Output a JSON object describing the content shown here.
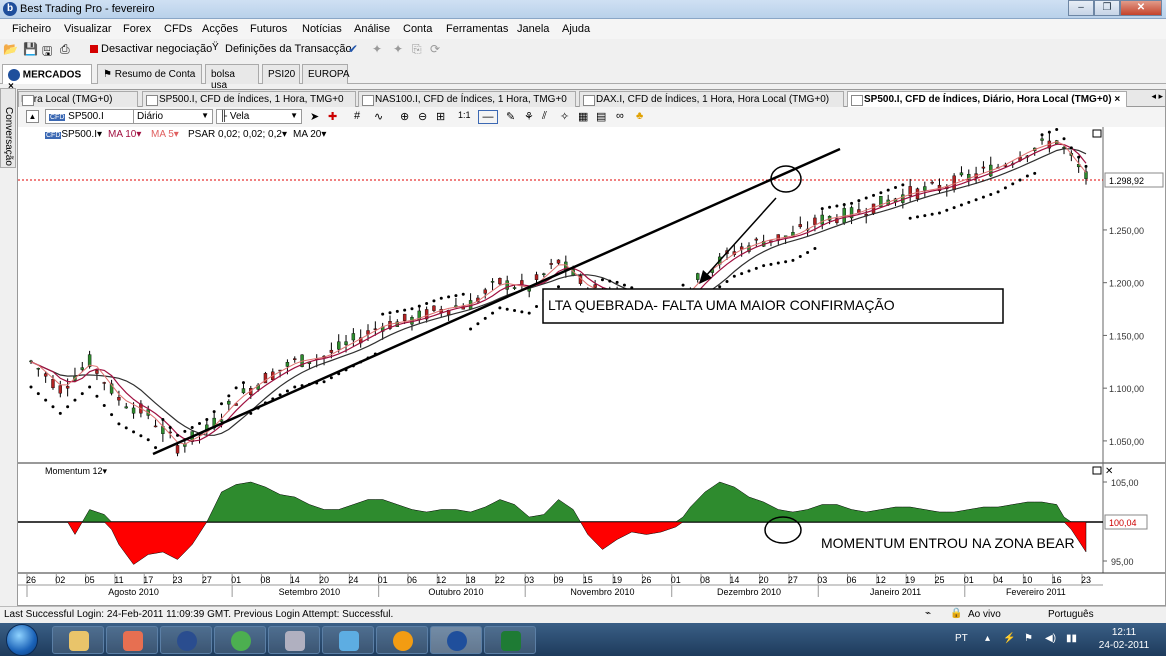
{
  "window": {
    "title": "Best Trading Pro - fevereiro",
    "app_icon": "b"
  },
  "menu": [
    "Ficheiro",
    "Visualizar",
    "Forex",
    "CFDs",
    "Acções",
    "Futuros",
    "Notícias",
    "Análise",
    "Conta",
    "Ferramentas",
    "Janela",
    "Ajuda"
  ],
  "toolbar": {
    "deactivate_label": "Desactivar negociação",
    "settings_label": "Definições da Transacção"
  },
  "top_tabs": [
    {
      "label": "MERCADOS",
      "close": "×"
    },
    {
      "label": "Resumo de Conta"
    },
    {
      "label": "bolsa usa"
    },
    {
      "label": "PSI20"
    },
    {
      "label": "EUROPA"
    }
  ],
  "side_tab": "Conversação",
  "chart_tabs": [
    "Hora Local (TMG+0)",
    "SP500.I, CFD de Índices, 1 Hora, TMG+0",
    "NAS100.I, CFD de Índices, 1 Hora, TMG+0",
    "DAX.I, CFD de Índices, 1 Hora, Hora Local (TMG+0)",
    "SP500.I, CFD de Índices, Diário, Hora Local (TMG+0)"
  ],
  "chart_toolbar": {
    "symbol": "SP500.I",
    "symbol_badge": "CFD",
    "period": "Diário",
    "chart_type": "Vela"
  },
  "indicators": {
    "symbol_label": "SP500.I",
    "ma10": "MA 10",
    "ma5": "MA 5",
    "psar": "PSAR 0,02; 0,02; 0,2",
    "ma20": "MA 20",
    "momentum": "Momentum 12"
  },
  "colors": {
    "candle_up": "#2e8b2e",
    "candle_down": "#b22222",
    "ma10": "#a01040",
    "ma5": "#e07070",
    "ma20": "#303030",
    "momentum_up": "#2e8b2e",
    "momentum_down": "#ff0000",
    "current_price_line": "#e00000"
  },
  "annotations": {
    "box1": "LTA QUEBRADA- FALTA UMA MAIOR CONFIRMAÇÃO",
    "text2": "MOMENTUM ENTROU NA ZONA BEAR"
  },
  "price_axis": [
    "1.250,00",
    "1.200,00",
    "1.150,00",
    "1.100,00",
    "1.050,00"
  ],
  "current_price": "1.298,92",
  "momentum_axis": [
    "105,00",
    "95,00"
  ],
  "current_momentum": "100,04",
  "x_days": [
    "26",
    "02",
    "05",
    "11",
    "17",
    "23",
    "27",
    "01",
    "08",
    "14",
    "20",
    "24",
    "01",
    "06",
    "12",
    "18",
    "22",
    "03",
    "09",
    "15",
    "19",
    "26",
    "01",
    "08",
    "14",
    "20",
    "27",
    "03",
    "06",
    "12",
    "19",
    "25",
    "01",
    "04",
    "10",
    "16",
    "23"
  ],
  "x_months": [
    "Agosto 2010",
    "Setembro 2010",
    "Outubro 2010",
    "Novembro 2010",
    "Dezembro 2010",
    "Janeiro 2011",
    "Fevereiro 2011"
  ],
  "chart_data": {
    "type": "line",
    "series": [
      {
        "values": [
          1125,
          1100,
          1125,
          1090,
          1075,
          1045,
          1060,
          1090,
          1110,
          1125,
          1130,
          1145,
          1160,
          1165,
          1175,
          1180,
          1200,
          1195,
          1220,
          1195,
          1190,
          1180,
          1180,
          1210,
          1230,
          1240,
          1245,
          1260,
          1265,
          1275,
          1285,
          1290,
          1300,
          1310,
          1325,
          1335,
          1300
        ]
      }
    ],
    "x": [
      "26",
      "02",
      "05",
      "11",
      "17",
      "23",
      "27",
      "01",
      "08",
      "14",
      "20",
      "24",
      "01",
      "06",
      "12",
      "18",
      "22",
      "03",
      "09",
      "15",
      "19",
      "26",
      "01",
      "08",
      "14",
      "20",
      "27",
      "03",
      "06",
      "12",
      "19",
      "25",
      "01",
      "04",
      "10",
      "16",
      "23"
    ],
    "ylim": [
      1030,
      1340
    ]
  },
  "status": {
    "login": "Last Successful Login: 24-Feb-2011 11:09:39 GMT. Previous Login Attempt: Successful.",
    "live": "Ao vivo",
    "language": "Português"
  },
  "taskbar": {
    "lang": "PT",
    "time": "12:11",
    "date": "24-02-2011"
  }
}
